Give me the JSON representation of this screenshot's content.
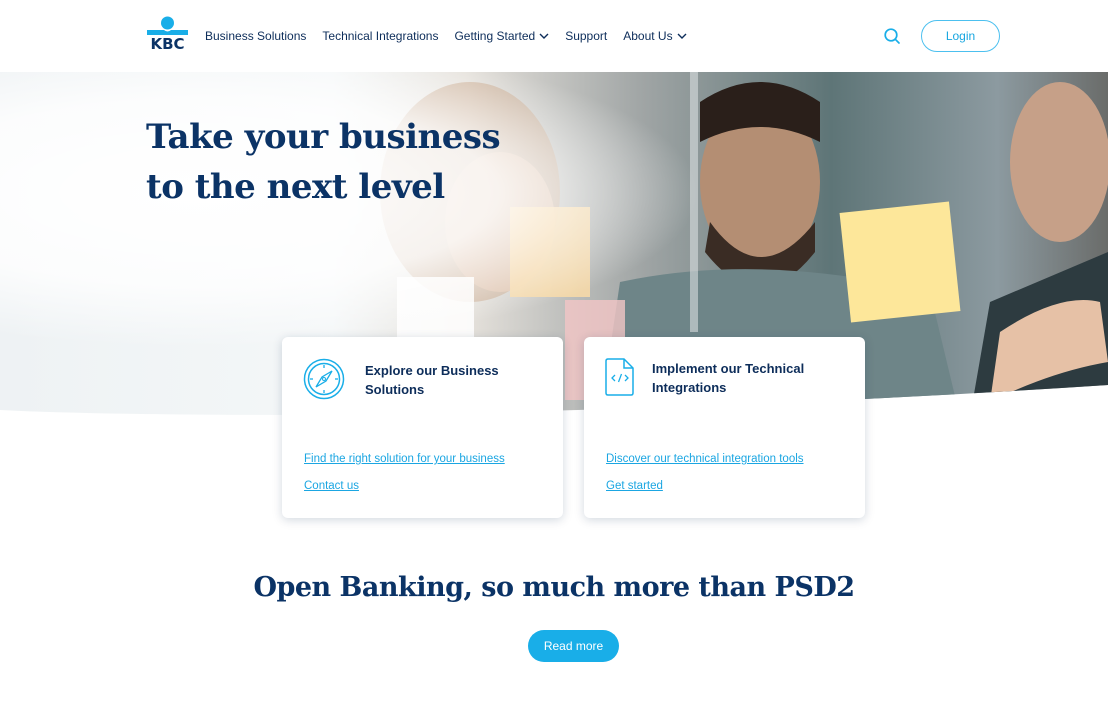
{
  "brand": {
    "logo_text": "KBC",
    "primary_color": "#0b3366",
    "accent_color": "#19aee8"
  },
  "nav": {
    "items": [
      {
        "label": "Business Solutions",
        "has_dropdown": false
      },
      {
        "label": "Technical Integrations",
        "has_dropdown": false
      },
      {
        "label": "Getting Started",
        "has_dropdown": true
      },
      {
        "label": "Support",
        "has_dropdown": false
      },
      {
        "label": "About Us",
        "has_dropdown": true
      }
    ],
    "search_icon": "search-icon",
    "login_label": "Login"
  },
  "hero": {
    "title_line1": "Take your business",
    "title_line2": "to the next level",
    "image": "people-collaborating-sticky-notes-photo"
  },
  "cards": [
    {
      "icon": "compass-icon",
      "title": "Explore our Business Solutions",
      "links": [
        "Find the right solution for your business",
        "Contact us"
      ]
    },
    {
      "icon": "code-file-icon",
      "title": "Implement our Technical Integrations",
      "links": [
        "Discover our technical integration tools",
        "Get started"
      ]
    }
  ],
  "section": {
    "title": "Open Banking, so much more than PSD2",
    "button_label": "Read more"
  }
}
